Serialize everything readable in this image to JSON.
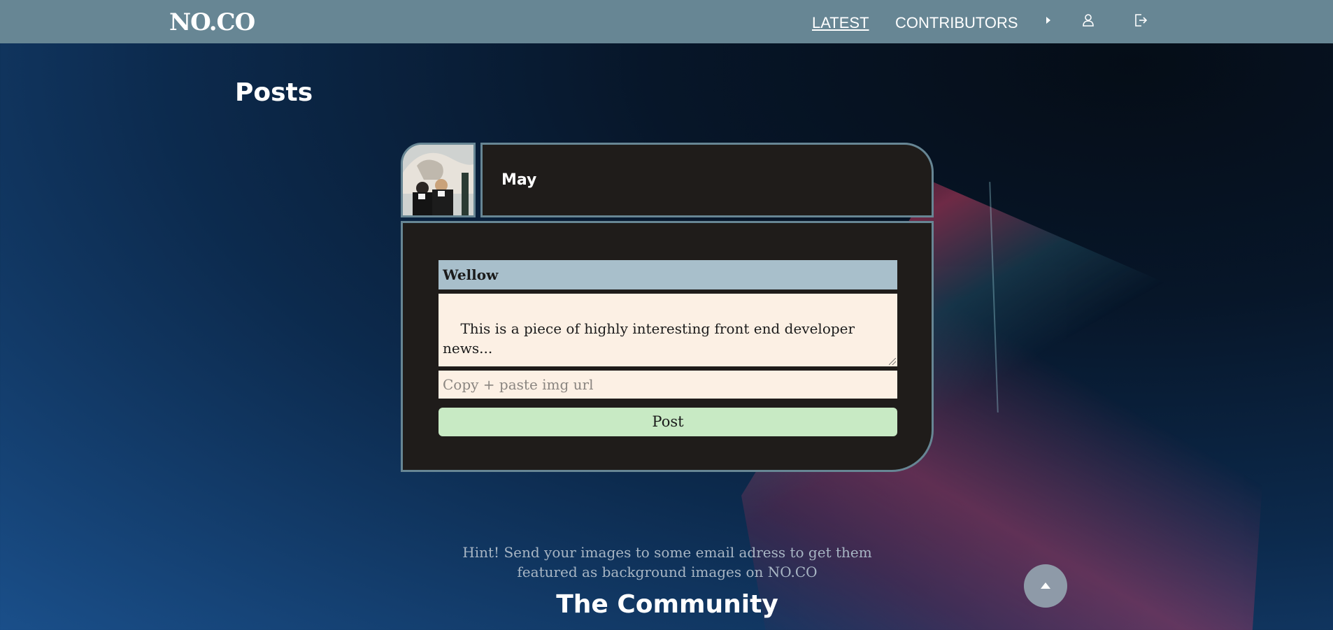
{
  "header": {
    "logo": "NO.CO",
    "nav": [
      {
        "label": "LATEST",
        "active": true
      },
      {
        "label": "CONTRIBUTORS",
        "active": false
      }
    ],
    "icons": [
      "caret-right-icon",
      "user-icon",
      "logout-icon"
    ]
  },
  "main": {
    "title": "Posts",
    "author": {
      "name": "May",
      "avatar": "avatar-photo"
    },
    "form": {
      "title_value": "Wellow",
      "body_value": "This is a piece of highly interesting front end developer news...\n\nTo begin the article, it is",
      "image_placeholder": "Copy + paste img url",
      "submit_label": "Post"
    }
  },
  "footer": {
    "hint": "Hint! Send your images to some email adress to get them featured as background images on NO.CO",
    "community_title": "The Community"
  },
  "colors": {
    "header_bg": "#678694",
    "panel_bg": "#1f1c1a",
    "panel_border": "#678694",
    "title_input_bg": "#a8bfcb",
    "input_bg": "#fcf0e4",
    "button_bg": "#c8eac4",
    "scroll_button_bg": "#8e9aa8"
  }
}
